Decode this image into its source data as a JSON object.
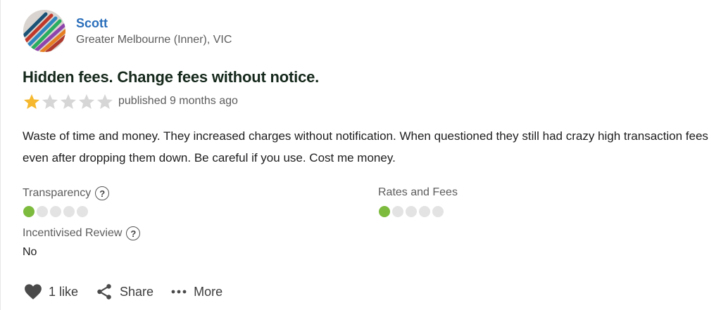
{
  "reviewer": {
    "name": "Scott",
    "location": "Greater Melbourne (Inner), VIC"
  },
  "review": {
    "title": "Hidden fees. Change fees without notice.",
    "rating": 1,
    "rating_max": 5,
    "published": "published 9 months ago",
    "body": "Waste of time and money. They increased charges without notification. When questioned they still had crazy high transaction fees even after dropping them down. Be careful if you use. Cost me money."
  },
  "metrics": [
    {
      "label": "Transparency",
      "score": 1,
      "max": 5,
      "help_icon": "question-circle-icon"
    },
    {
      "label": "Rates and Fees",
      "score": 1,
      "max": 5
    }
  ],
  "incentivised": {
    "label": "Incentivised Review",
    "value": "No",
    "help_icon": "question-circle-icon"
  },
  "actions": {
    "like_label": "1 like",
    "share_label": "Share",
    "more_label": "More"
  },
  "colors": {
    "name_link": "#2a6ebb",
    "star_filled": "#f5b82e",
    "star_empty": "#d6d6d6",
    "dot_on": "#7dbb3e",
    "dot_off": "#e3e3e3",
    "title": "#15281b"
  }
}
